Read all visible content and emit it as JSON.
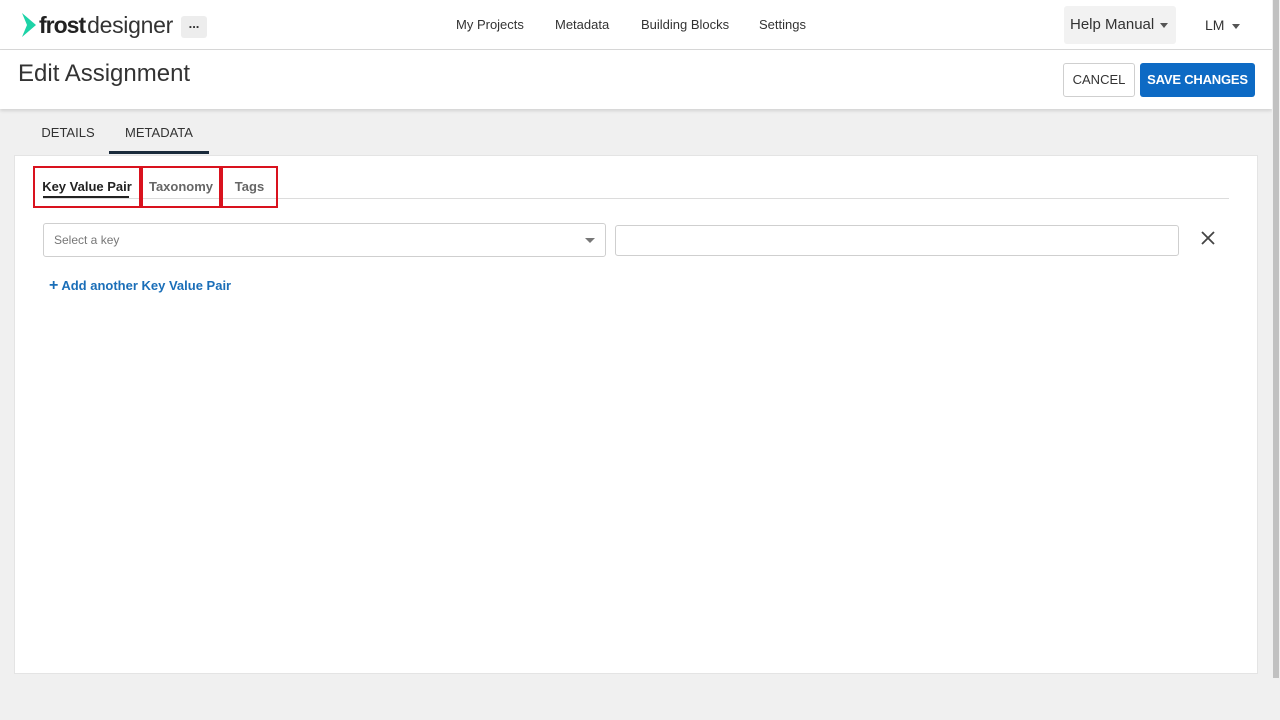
{
  "app": {
    "brand_bold": "frost",
    "brand_light": "designer",
    "more_label": "...",
    "accent_color": "#1dd3a7"
  },
  "nav": {
    "items": [
      "My Projects",
      "Metadata",
      "Building Blocks",
      "Settings"
    ],
    "help_label": "Help Manual",
    "user_label": "LM"
  },
  "page": {
    "title": "Edit Assignment",
    "cancel_label": "CANCEL",
    "save_label": "SAVE CHANGES",
    "save_color": "#0d6ac4"
  },
  "main_tabs": [
    {
      "label": "DETAILS",
      "active": false
    },
    {
      "label": "METADATA",
      "active": true
    }
  ],
  "sub_tabs": [
    {
      "label": "Key Value Pair",
      "active": true
    },
    {
      "label": "Taxonomy",
      "active": false
    },
    {
      "label": "Tags",
      "active": false
    }
  ],
  "kv_row": {
    "key_placeholder": "Select a key",
    "value": "",
    "remove_icon": "close-icon"
  },
  "add_pair_label": "Add another Key Value Pair",
  "highlight_color": "#d9121e"
}
